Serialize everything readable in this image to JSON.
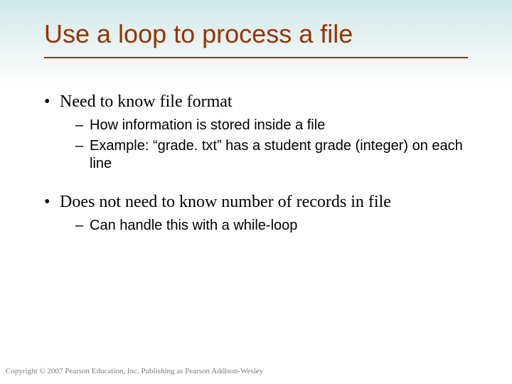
{
  "slide": {
    "title": "Use a loop to process a file",
    "bullets": [
      {
        "text": "Need to know file format",
        "sub": [
          "How information is stored inside a file",
          "Example: “grade. txt” has a student grade (integer) on each line"
        ]
      },
      {
        "text": "Does not need to know number of records in file",
        "sub": [
          "Can handle this with a while-loop"
        ]
      }
    ],
    "footer": "Copyright © 2007 Pearson Education, Inc. Publishing as Pearson Addison-Wesley"
  }
}
